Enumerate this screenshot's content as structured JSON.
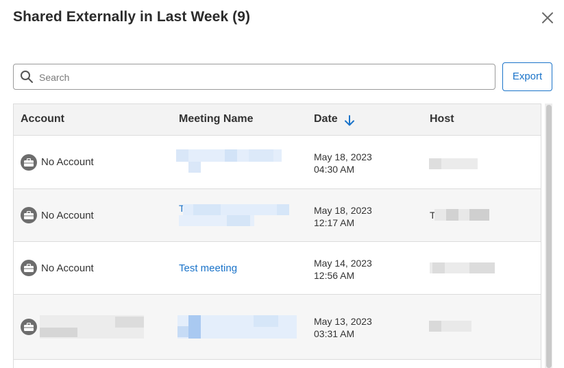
{
  "dialog": {
    "title": "Shared Externally in Last Week (9)",
    "close_icon": "close-icon"
  },
  "search": {
    "placeholder": "Search",
    "value": "",
    "icon": "search-icon"
  },
  "export_label": "Export",
  "table": {
    "headers": {
      "account": "Account",
      "meeting": "Meeting Name",
      "date": "Date",
      "host": "Host"
    },
    "sort": {
      "column": "Date",
      "direction": "descending",
      "icon": "arrow-down-icon"
    },
    "rows": [
      {
        "account": "No Account",
        "meeting": "",
        "date": "May 18, 2023",
        "time": "04:30 AM",
        "host": ""
      },
      {
        "account": "No Account",
        "meeting": "T",
        "date": "May 18, 2023",
        "time": "12:17 AM",
        "host": "T"
      },
      {
        "account": "No Account",
        "meeting": "Test meeting",
        "date": "May 14, 2023",
        "time": "12:56 AM",
        "host": ""
      },
      {
        "account": "",
        "meeting": "",
        "date": "May 13, 2023",
        "time": "03:31 AM",
        "host": ""
      }
    ]
  },
  "colors": {
    "accent": "#1a73c9",
    "header_bg": "#f3f3f3",
    "icon_gray": "#6d6d6d",
    "redaction": "#dde9f8"
  }
}
